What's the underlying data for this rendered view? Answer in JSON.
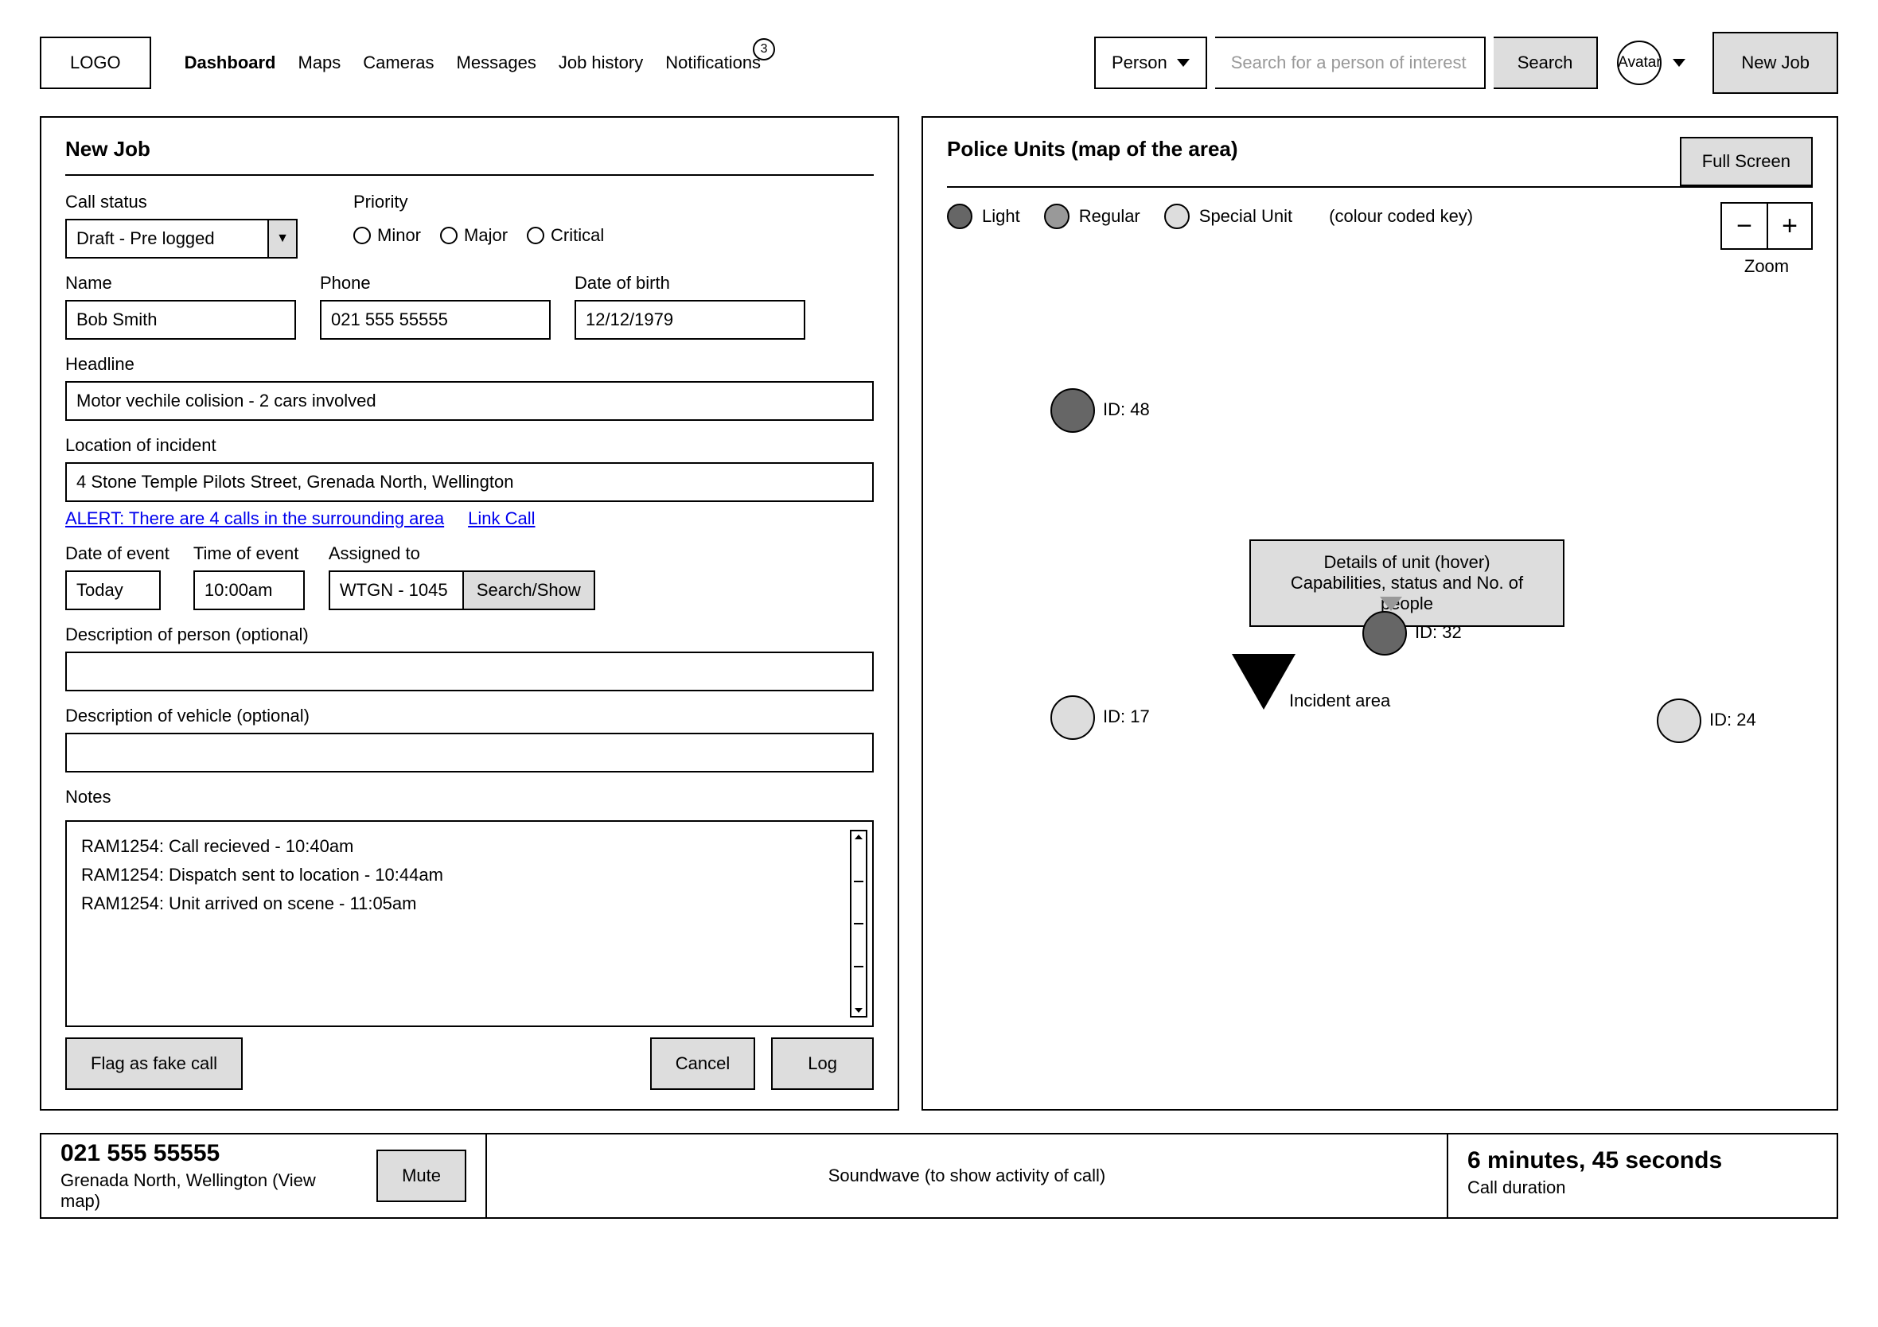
{
  "header": {
    "logo": "LOGO",
    "nav": {
      "dashboard": "Dashboard",
      "maps": "Maps",
      "cameras": "Cameras",
      "messages": "Messages",
      "jobHistory": "Job history",
      "notifications": "Notifications",
      "notifBadge": "3"
    },
    "search": {
      "type": "Person",
      "placeholder": "Search for a person of interest",
      "button": "Search"
    },
    "avatar": "Avatar",
    "newJob": "New Job"
  },
  "form": {
    "title": "New Job",
    "callStatus": {
      "label": "Call status",
      "value": "Draft - Pre logged"
    },
    "priority": {
      "label": "Priority",
      "minor": "Minor",
      "major": "Major",
      "critical": "Critical"
    },
    "name": {
      "label": "Name",
      "value": "Bob Smith"
    },
    "phone": {
      "label": "Phone",
      "value": "021 555 55555"
    },
    "dob": {
      "label": "Date of birth",
      "value": "12/12/1979"
    },
    "headline": {
      "label": "Headline",
      "value": "Motor vechile colision - 2 cars involved"
    },
    "location": {
      "label": "Location of incident",
      "value": "4 Stone Temple Pilots Street, Grenada North, Wellington"
    },
    "alert": "ALERT: There are 4 calls in the surrounding area",
    "linkCall": "Link Call",
    "dateEvent": {
      "label": "Date of event",
      "value": "Today"
    },
    "timeEvent": {
      "label": "Time of event",
      "value": "10:00am"
    },
    "assigned": {
      "label": "Assigned to",
      "value": "WTGN - 1045",
      "button": "Search/Show"
    },
    "descPerson": {
      "label": "Description of person (optional)",
      "value": ""
    },
    "descVehicle": {
      "label": "Description of vehicle (optional)",
      "value": ""
    },
    "notes": {
      "label": "Notes",
      "line1": "RAM1254: Call recieved - 10:40am",
      "line2": "RAM1254: Dispatch sent to location - 10:44am",
      "line3": "RAM1254: Unit arrived on scene - 11:05am"
    },
    "flagBtn": "Flag as fake call",
    "cancelBtn": "Cancel",
    "logBtn": "Log"
  },
  "map": {
    "title": "Police Units (map of the area)",
    "fullscreen": "Full Screen",
    "legend": {
      "light": "Light",
      "regular": "Regular",
      "special": "Special Unit",
      "note": "(colour coded key)"
    },
    "zoom": "Zoom",
    "u48": "ID: 48",
    "u32": "ID: 32",
    "u17": "ID: 17",
    "u24": "ID: 24",
    "tooltip1": "Details of unit (hover)",
    "tooltip2": "Capabilities, status and No. of people",
    "incident": "Incident area"
  },
  "footer": {
    "phone": "021 555 55555",
    "location": "Grenada North, Wellington (View map)",
    "mute": "Mute",
    "soundwave": "Soundwave (to show activity of call)",
    "duration": "6 minutes, 45 seconds",
    "durationLabel": "Call duration"
  }
}
